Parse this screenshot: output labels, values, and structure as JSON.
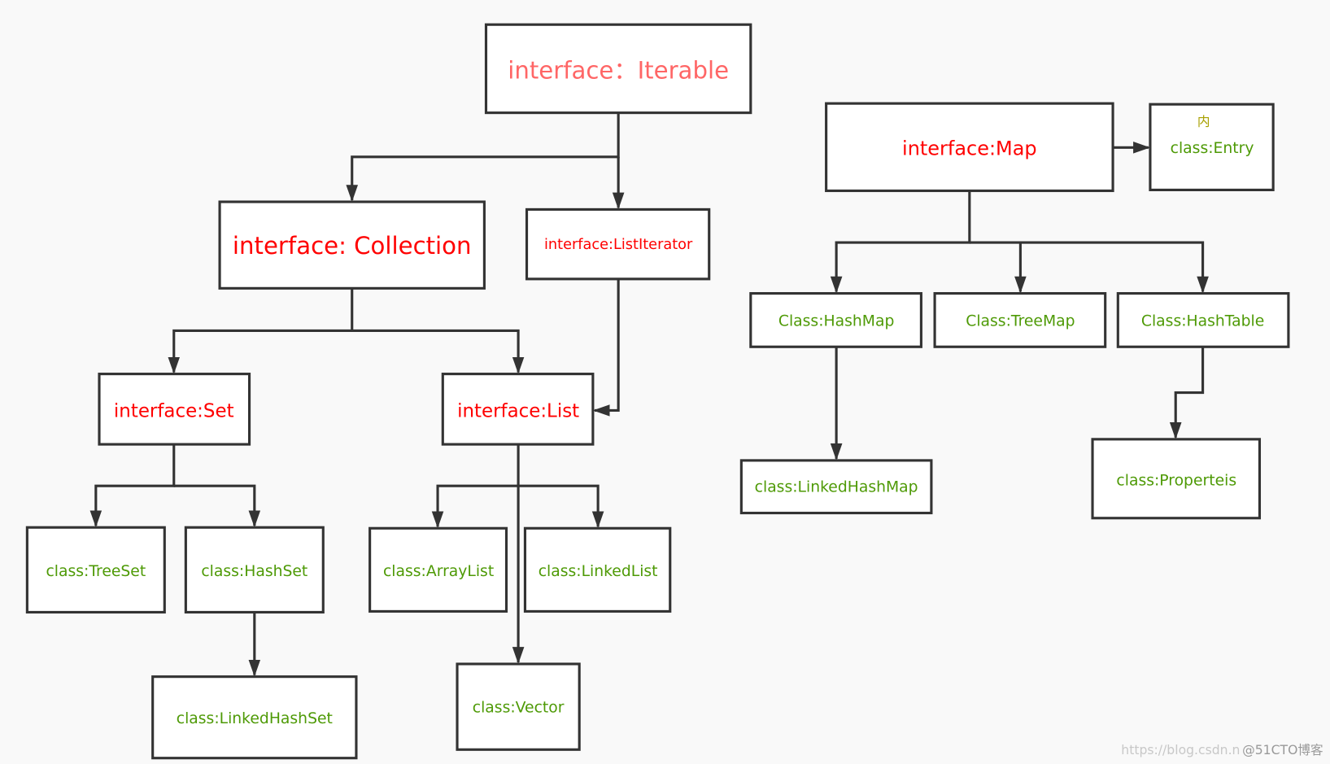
{
  "nodes": {
    "iterable": "interface：Iterable",
    "collection": "interface: Collection",
    "list_iterator": "interface:ListIterator",
    "map": "interface:Map",
    "entry_note": "内",
    "entry": "class:Entry",
    "hashmap": "Class:HashMap",
    "treemap": "Class:TreeMap",
    "hashtable": "Class:HashTable",
    "linkedhashmap": "class:LinkedHashMap",
    "properteis": "class:Properteis",
    "set": "interface:Set",
    "list": "interface:List",
    "treeset": "class:TreeSet",
    "hashset": "class:HashSet",
    "linkedhashset": "class:LinkedHashSet",
    "arraylist": "class:ArrayList",
    "linkedlist": "class:LinkedList",
    "vector": "class:Vector"
  },
  "colors": {
    "interface": "#ff0000",
    "iterable": "#ff6666",
    "class": "#4e9a06",
    "edge": "#333333"
  },
  "watermark": {
    "url": "https://blog.csdn.n",
    "site": "@51CTO博客"
  }
}
